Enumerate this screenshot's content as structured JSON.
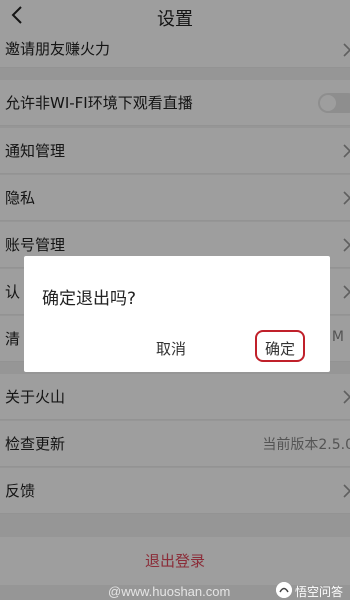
{
  "header": {
    "title": "设置"
  },
  "rows": [
    {
      "label": "邀请朋友赚火力"
    },
    {
      "label": "允许非WI-FI环境下观看直播"
    },
    {
      "label": "通知管理"
    },
    {
      "label": "隐私"
    },
    {
      "label": "账号管理"
    },
    {
      "label": "认"
    },
    {
      "label": "清",
      "value": "M"
    },
    {
      "label": "关于火山"
    },
    {
      "label": "检查更新",
      "value": "当前版本2.5.0"
    },
    {
      "label": "反馈"
    }
  ],
  "toggles": {
    "wifi_live": false
  },
  "logout": {
    "label": "退出登录"
  },
  "dialog": {
    "message": "确定退出吗?",
    "cancel": "取消",
    "confirm": "确定"
  },
  "watermark": {
    "text": "@www.huoshan.com"
  },
  "badge": {
    "text": "悟空问答"
  },
  "colors": {
    "accent": "#e04a5c",
    "highlight_ring": "#c0202a"
  }
}
